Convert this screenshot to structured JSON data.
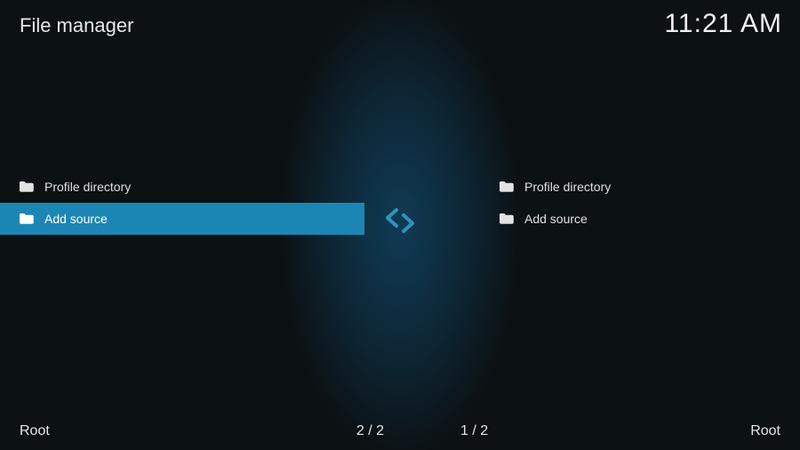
{
  "header": {
    "title": "File manager",
    "clock": "11:21 AM"
  },
  "left": {
    "items": [
      {
        "label": "Profile directory",
        "selected": false
      },
      {
        "label": "Add source",
        "selected": true
      }
    ],
    "footer_path": "Root",
    "footer_count": "2 / 2"
  },
  "right": {
    "items": [
      {
        "label": "Profile directory",
        "selected": false
      },
      {
        "label": "Add source",
        "selected": false
      }
    ],
    "footer_path": "Root",
    "footer_count": "1 / 2"
  },
  "colors": {
    "accent": "#1b86b4",
    "arrow": "#2c93bf"
  }
}
